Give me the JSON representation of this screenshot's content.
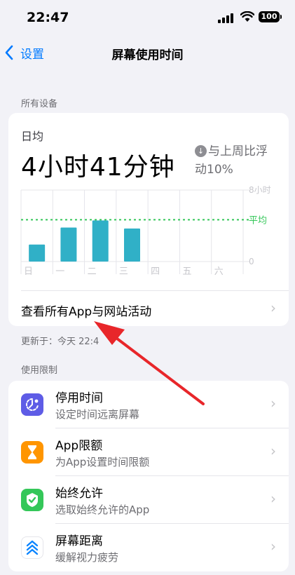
{
  "status": {
    "time": "22:47",
    "battery": "100"
  },
  "nav": {
    "back_label": "设置",
    "title": "屏幕使用时间"
  },
  "devices_section": {
    "header": "所有设备"
  },
  "summary": {
    "label": "日均",
    "total": "4小时41分钟",
    "trend_line1": "与上周比浮",
    "trend_line2": "动10%"
  },
  "chart_data": {
    "type": "bar",
    "categories": [
      "日",
      "一",
      "二",
      "三",
      "四",
      "五",
      "六"
    ],
    "values": [
      1.9,
      3.8,
      4.6,
      3.7,
      0,
      0,
      0
    ],
    "average": 4.68,
    "average_label": "平均",
    "ylim": [
      0,
      8
    ],
    "yticks": [
      "8小时",
      "0"
    ],
    "bar_color": "#30b0c7",
    "average_color": "#34c759"
  },
  "activity": {
    "label": "查看所有App与网站活动",
    "updated": "更新于：今天 22:4"
  },
  "limits": {
    "header": "使用限制",
    "items": [
      {
        "title": "停用时间",
        "subtitle": "设定时间远离屏幕",
        "icon": "downtime-icon",
        "color": "#5e5ce6"
      },
      {
        "title": "App限额",
        "subtitle": "为App设置时间限额",
        "icon": "hourglass-icon",
        "color": "#ff9500"
      },
      {
        "title": "始终允许",
        "subtitle": "选取始终允许的App",
        "icon": "checkmark-shield-icon",
        "color": "#34c759"
      },
      {
        "title": "屏幕距离",
        "subtitle": "缓解视力疲劳",
        "icon": "screen-distance-icon",
        "color": "#ffffff"
      }
    ]
  }
}
